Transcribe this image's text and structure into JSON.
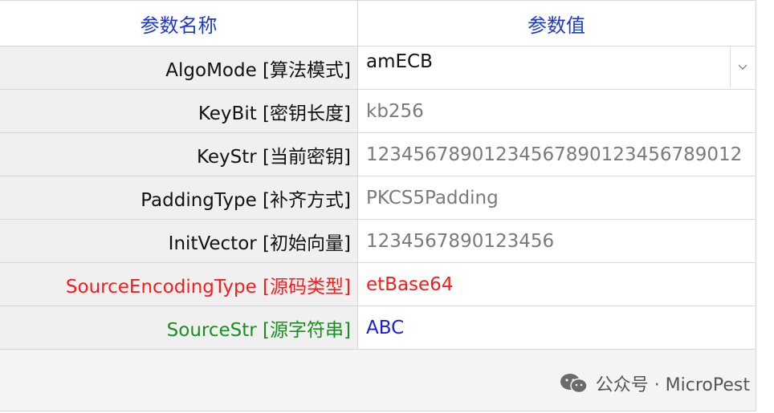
{
  "header": {
    "name_col": "参数名称",
    "value_col": "参数值"
  },
  "rows": [
    {
      "name": "AlgoMode [算法模式]",
      "value": "amECB",
      "type": "dropdown"
    },
    {
      "name": "KeyBit [密钥长度]",
      "value": "kb256"
    },
    {
      "name": "KeyStr [当前密钥]",
      "value": "12345678901234567890123456789012"
    },
    {
      "name": "PaddingType [补齐方式]",
      "value": "PKCS5Padding"
    },
    {
      "name": "InitVector [初始向量]",
      "value": "1234567890123456"
    },
    {
      "name": "SourceEncodingType [源码类型]",
      "value": "etBase64"
    },
    {
      "name": "SourceStr [源字符串]",
      "value": "ABC"
    }
  ],
  "watermark": {
    "text": "公众号 · MicroPest",
    "icon": "wechat-icon"
  },
  "colors": {
    "header_text": "#1a39d6",
    "highlight_red": "#ff1a1a",
    "highlight_green": "#17901f",
    "highlight_blue": "#1a1ae6",
    "grid_line": "#d7d7d7"
  }
}
